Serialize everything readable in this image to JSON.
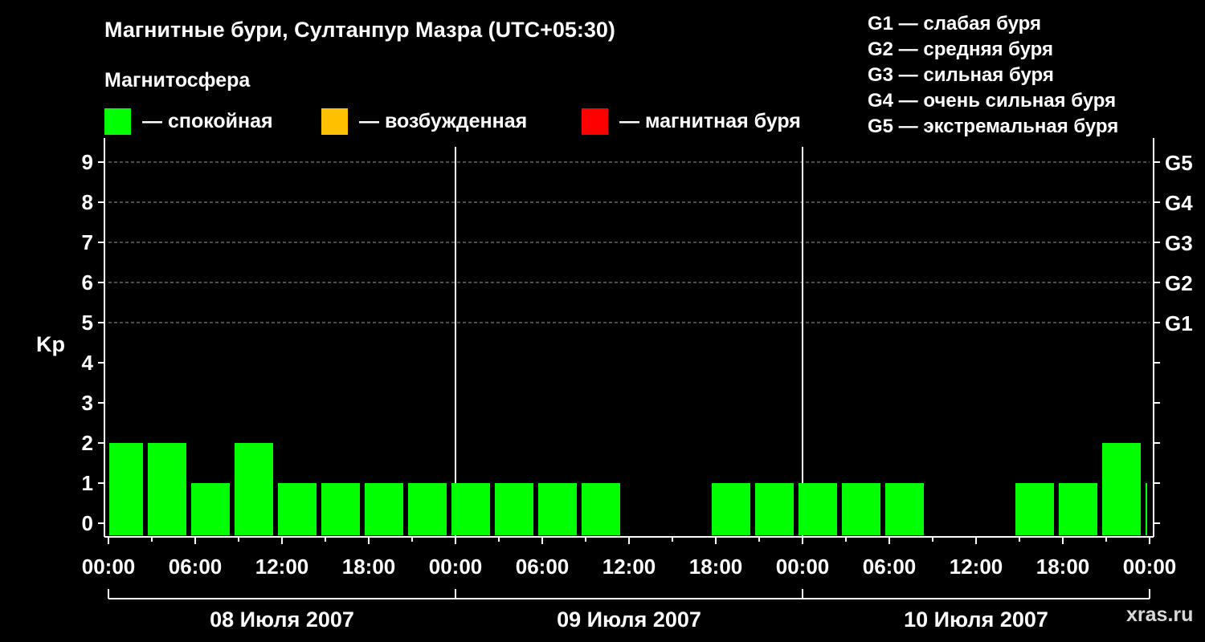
{
  "header": {
    "title": "Магнитные бури, Султанпур Мазра (UTC+05:30)",
    "subtitle": "Магнитосфера"
  },
  "legend": [
    {
      "label": "— спокойная",
      "color": "#00ff00"
    },
    {
      "label": "— возбужденная",
      "color": "#ffc000"
    },
    {
      "label": "— магнитная буря",
      "color": "#ff0000"
    }
  ],
  "g_legend": [
    "G1 — слабая буря",
    "G2 — средняя буря",
    "G3 — сильная буря",
    "G4 — очень сильная буря",
    "G5 — экстремальная буря"
  ],
  "watermark": "xras.ru",
  "chart_data": {
    "type": "bar",
    "ylabel": "Kp",
    "ylim": [
      0,
      9
    ],
    "yticks": [
      "0",
      "1",
      "2",
      "3",
      "4",
      "5",
      "6",
      "7",
      "8",
      "9"
    ],
    "right_axis_labels": [
      {
        "kp": 5,
        "label": "G1"
      },
      {
        "kp": 6,
        "label": "G2"
      },
      {
        "kp": 7,
        "label": "G3"
      },
      {
        "kp": 8,
        "label": "G4"
      },
      {
        "kp": 9,
        "label": "G5"
      }
    ],
    "grid": "dashed horizontal at Kp 5–9",
    "x_tick_labels": [
      "00:00",
      "06:00",
      "12:00",
      "18:00",
      "00:00",
      "06:00",
      "12:00",
      "18:00",
      "00:00",
      "06:00",
      "12:00",
      "18:00",
      "00:00"
    ],
    "days": [
      "08 Июля 2007",
      "09 Июля 2007",
      "10 Июля 2007"
    ],
    "series": [
      {
        "values": [
          {
            "t": "2007-07-08 00:00",
            "kp": 2
          },
          {
            "t": "2007-07-08 02:30",
            "kp": 2
          },
          {
            "t": "2007-07-08 05:30",
            "kp": 1
          },
          {
            "t": "2007-07-08 08:30",
            "kp": 2
          },
          {
            "t": "2007-07-08 11:30",
            "kp": 1
          },
          {
            "t": "2007-07-08 14:30",
            "kp": 1
          },
          {
            "t": "2007-07-08 17:30",
            "kp": 1
          },
          {
            "t": "2007-07-08 20:30",
            "kp": 1
          },
          {
            "t": "2007-07-08 23:30",
            "kp": 1
          },
          {
            "t": "2007-07-09 02:30",
            "kp": 1
          },
          {
            "t": "2007-07-09 05:30",
            "kp": 1
          },
          {
            "t": "2007-07-09 08:30",
            "kp": 1
          },
          {
            "t": "2007-07-09 11:30",
            "kp": 0
          },
          {
            "t": "2007-07-09 14:30",
            "kp": 0
          },
          {
            "t": "2007-07-09 17:30",
            "kp": 1
          },
          {
            "t": "2007-07-09 20:30",
            "kp": 1
          },
          {
            "t": "2007-07-09 23:30",
            "kp": 1
          },
          {
            "t": "2007-07-10 02:30",
            "kp": 1
          },
          {
            "t": "2007-07-10 05:30",
            "kp": 1
          },
          {
            "t": "2007-07-10 08:30",
            "kp": 0
          },
          {
            "t": "2007-07-10 11:30",
            "kp": 0
          },
          {
            "t": "2007-07-10 14:30",
            "kp": 1
          },
          {
            "t": "2007-07-10 17:30",
            "kp": 1
          },
          {
            "t": "2007-07-10 20:30",
            "kp": 2
          },
          {
            "t": "2007-07-10 23:30",
            "kp": 1
          }
        ]
      }
    ]
  }
}
